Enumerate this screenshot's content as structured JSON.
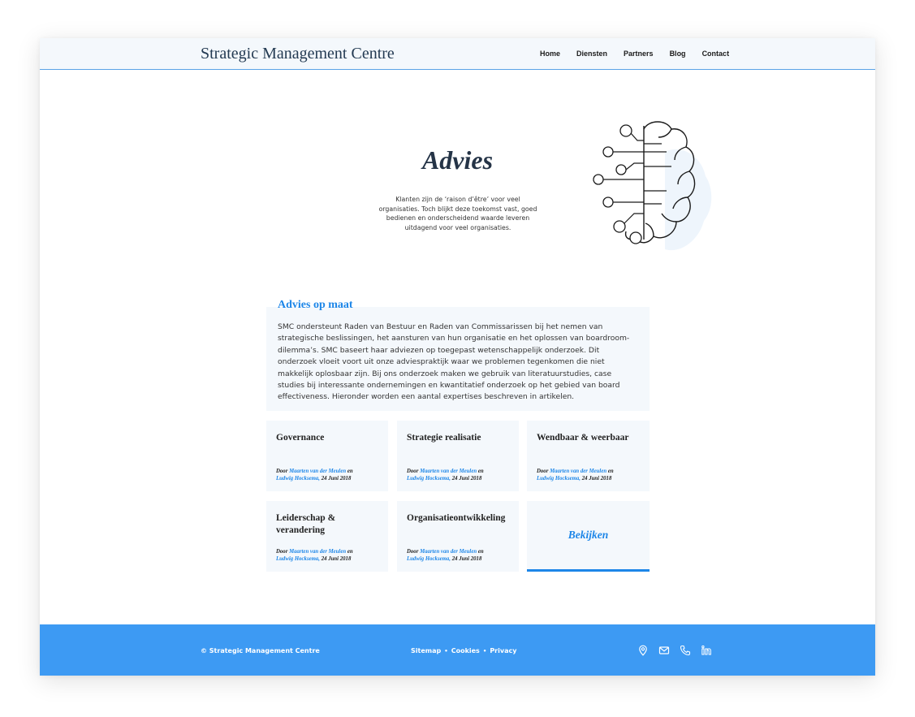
{
  "header": {
    "brand": "Strategic Management Centre",
    "nav": [
      "Home",
      "Diensten",
      "Partners",
      "Blog",
      "Contact"
    ]
  },
  "hero": {
    "title": "Advies",
    "text": "Klanten zijn de ‘raison d’être’ voor veel organisaties. Toch blijkt deze toekomst vast, goed bedienen en onderscheidend waarde leveren uitdagend voor veel organisaties."
  },
  "section": {
    "title": "Advies op maat",
    "text": "SMC ondersteunt Raden van Bestuur en Raden van Commissarissen bij het nemen van strategische beslissingen, het aansturen van hun organisatie en het oplossen van boardroom-dilemma’s. SMC baseert haar adviezen op toegepast wetenschappelijk onderzoek. Dit onderzoek vloeit voort uit onze adviespraktijk waar we problemen tegenkomen die niet makkelijk oplosbaar zijn. Bij ons onderzoek maken we gebruik van literatuurstudies, case studies bij interessante ondernemingen en kwantitatief onderzoek op het gebied van board effectiveness. Hieronder worden een aantal expertises beschreven in artikelen."
  },
  "cards": [
    {
      "title": "Governance",
      "by": "Door",
      "author1": "Maarten van der Meulen",
      "and": "en",
      "author2": "Ludwig Hocksema,",
      "date": "24 Juni 2018"
    },
    {
      "title": "Strategie realisatie",
      "by": "Door",
      "author1": "Maarten van der Meulen",
      "and": "en",
      "author2": "Ludwig Hocksema,",
      "date": "24 Juni 2018"
    },
    {
      "title": "Wendbaar & weerbaar",
      "by": "Door",
      "author1": "Maarten van der Meulen",
      "and": "en",
      "author2": "Ludwig Hocksema,",
      "date": "24 Juni 2018"
    },
    {
      "title": "Leiderschap & verandering",
      "by": "Door",
      "author1": "Maarten van der Meulen",
      "and": "en",
      "author2": "Ludwig Hocksema,",
      "date": "24 Juni 2018"
    },
    {
      "title": "Organisatieontwikkeling",
      "by": "Door",
      "author1": "Maarten van der Meulen",
      "and": "en",
      "author2": "Ludwig Hocksema,",
      "date": "24 Juni 2018"
    }
  ],
  "view_label": "Bekijken",
  "footer": {
    "copyright": "© Strategic Management Centre",
    "links": [
      "Sitemap",
      "Cookies",
      "Privacy"
    ],
    "separator": "•",
    "icons": [
      "location-icon",
      "mail-icon",
      "phone-icon",
      "linkedin-icon"
    ]
  },
  "colors": {
    "accent": "#1d86e8",
    "footer_bg": "#3d9af3",
    "card_bg": "#f4f8fc",
    "heading": "#253447"
  }
}
